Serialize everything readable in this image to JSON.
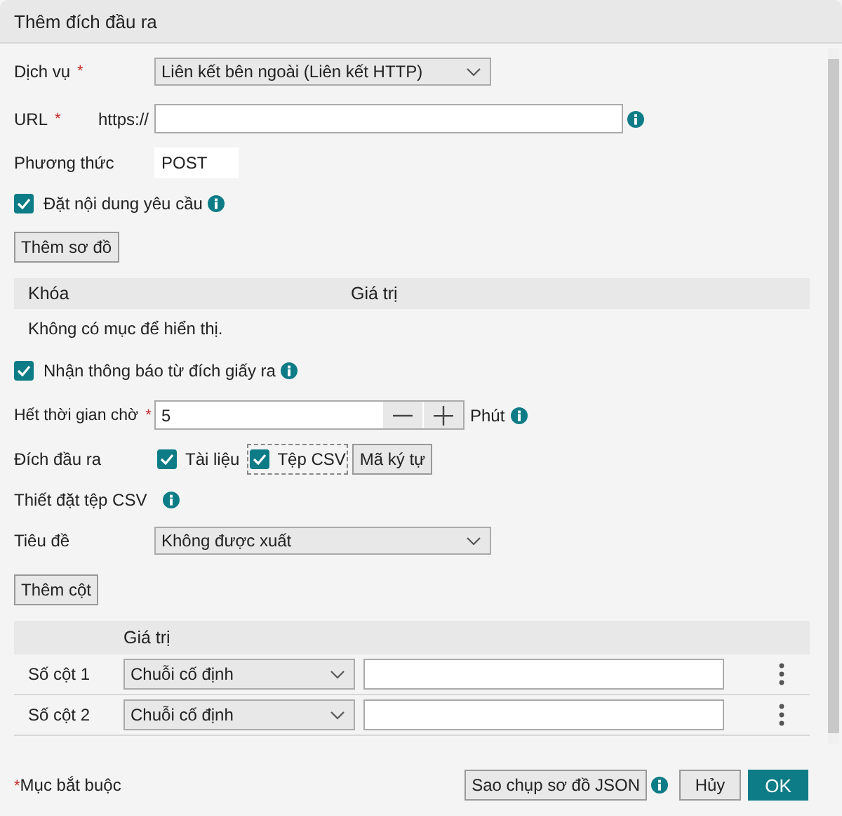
{
  "dialog_title": "Thêm đích đầu ra",
  "service": {
    "label": "Dịch vụ",
    "required_mark": "*",
    "value": "Liên kết bên ngoài (Liên kết HTTP)"
  },
  "url": {
    "label": "URL",
    "required_mark": "*",
    "prefix": "https://"
  },
  "method": {
    "label": "Phương thức",
    "value": "POST"
  },
  "set_request_body": {
    "label": "Đặt nội dung yêu cầu",
    "checked": true
  },
  "add_schema_button": "Thêm sơ đồ",
  "body_table": {
    "columns": [
      "Khóa",
      "Giá trị"
    ],
    "empty_message": "Không có mục để hiển thị."
  },
  "receive_notification": {
    "label": "Nhận thông báo từ đích giấy ra",
    "checked": true
  },
  "timeout": {
    "label": "Hết thời gian chờ",
    "required_mark": "*",
    "value": "5",
    "unit": "Phút"
  },
  "output": {
    "label": "Đích đầu ra",
    "options": [
      {
        "label": "Tài liệu",
        "checked": true,
        "focused": false
      },
      {
        "label": "Tệp CSV",
        "checked": true,
        "focused": true
      }
    ],
    "encoding_button": "Mã ký tự"
  },
  "csv_settings_label": "Thiết đặt tệp CSV",
  "header": {
    "label": "Tiêu đề",
    "value": "Không được xuất"
  },
  "add_column_button": "Thêm cột",
  "columns_table": {
    "columns": [
      "Giá trị"
    ],
    "rows": [
      {
        "name": "Số cột 1",
        "type": "Chuỗi cố định"
      },
      {
        "name": "Số cột 2",
        "type": "Chuỗi cố định"
      }
    ]
  },
  "footer": {
    "required_mark": "*",
    "required_note": "Mục bắt buộc",
    "copy_json_button": "Sao chụp sơ đồ JSON",
    "cancel_button": "Hủy",
    "ok_button": "OK"
  }
}
